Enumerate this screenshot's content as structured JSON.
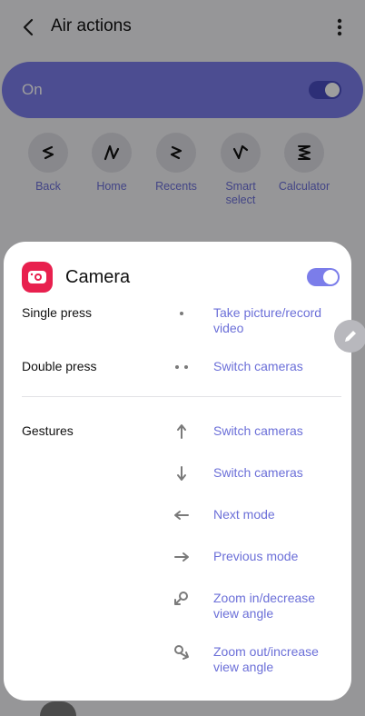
{
  "header": {
    "title": "Air actions",
    "back_icon": "back-arrow-icon",
    "more_icon": "more-vert-icon"
  },
  "master_toggle": {
    "label": "On",
    "state": "on"
  },
  "shortcuts": [
    {
      "label": "Back",
      "icon": "gesture-back-icon"
    },
    {
      "label": "Home",
      "icon": "gesture-home-icon"
    },
    {
      "label": "Recents",
      "icon": "gesture-recents-icon"
    },
    {
      "label": "Smart\nselect",
      "icon": "gesture-smart-select-icon"
    },
    {
      "label": "Calculator",
      "icon": "gesture-calculator-icon"
    }
  ],
  "sheet": {
    "app_name": "Camera",
    "app_icon": "camera-icon",
    "enabled": true,
    "single_press": {
      "label": "Single press",
      "action": "Take picture/record video",
      "icon": "single-dot-icon"
    },
    "double_press": {
      "label": "Double press",
      "action": "Switch cameras",
      "icon": "double-dot-icon"
    },
    "gestures_label": "Gestures",
    "gestures": [
      {
        "icon": "arrow-up-icon",
        "action": "Switch cameras"
      },
      {
        "icon": "arrow-down-icon",
        "action": "Switch cameras"
      },
      {
        "icon": "arrow-left-icon",
        "action": "Next mode"
      },
      {
        "icon": "arrow-right-icon",
        "action": "Previous mode"
      },
      {
        "icon": "circle-ccw-icon",
        "action": "Zoom in/decrease view angle"
      },
      {
        "icon": "circle-cw-icon",
        "action": "Zoom out/increase view angle"
      }
    ]
  },
  "colors": {
    "accent": "#7b7dea",
    "link": "#6b6fd8",
    "camera_red": "#e8204e"
  }
}
